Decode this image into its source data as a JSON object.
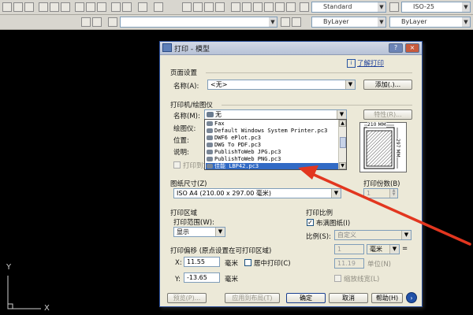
{
  "toolbar": {
    "text_style": "Standard",
    "dim_style": "ISO-25",
    "layer_color": "ByLayer",
    "linetype": "ByLayer"
  },
  "dialog": {
    "title": "打印 - 模型",
    "help_link": "了解打印",
    "page_setup": {
      "heading": "页面设置",
      "name_label": "名称(A):",
      "name_value": "<无>",
      "add_button": "添加(.)..."
    },
    "printer": {
      "heading": "打印机/绘图仪",
      "name_label": "名称(M):",
      "name_value": "无",
      "properties_button": "特性(R)...",
      "plotter_label": "绘图仪:",
      "location_label": "位置:",
      "description_label": "说明:",
      "print_to_file_label": "打印到文",
      "options": [
        "Fax",
        "Default Windows System Printer.pc3",
        "DWF6 ePlot.pc3",
        "DWG To PDF.pc3",
        "PublishToWeb JPG.pc3",
        "PublishToWeb PNG.pc3",
        "佳能 LBP42.pc3"
      ],
      "selected_option": "佳能 LBP42.pc3",
      "preview_width": "210 MM",
      "preview_height": "297 MM"
    },
    "paper": {
      "heading": "图纸尺寸(Z)",
      "value": "ISO A4 (210.00 x 297.00 毫米)"
    },
    "copies": {
      "heading": "打印份数(B)",
      "value": "1"
    },
    "area": {
      "heading": "打印区域",
      "range_label": "打印范围(W):",
      "range_value": "显示"
    },
    "offset": {
      "heading": "打印偏移 (原点设置在可打印区域)",
      "x_label": "X:",
      "x_value": "11.55",
      "y_label": "Y:",
      "y_value": "-13.65",
      "unit": "毫米",
      "center_label": "居中打印(C)"
    },
    "scale": {
      "heading": "打印比例",
      "fit_label": "布满图纸(I)",
      "fit_checked": true,
      "scale_label": "比例(S):",
      "scale_value": "自定义",
      "num_value": "1",
      "num_unit": "毫米",
      "den_value": "11.19",
      "den_unit": "单位(N)",
      "lineweight_label": "缩放线宽(L)"
    },
    "buttons": {
      "preview": "预览(P)...",
      "apply": "应用到布局(T)",
      "ok": "确定",
      "cancel": "取消",
      "help": "帮助(H)"
    }
  },
  "ucs": {
    "y": "Y",
    "x": "X"
  },
  "colors": {
    "selection": "#316ac5",
    "arrow": "#e2361f",
    "dialog_bg": "#ece9d8"
  }
}
